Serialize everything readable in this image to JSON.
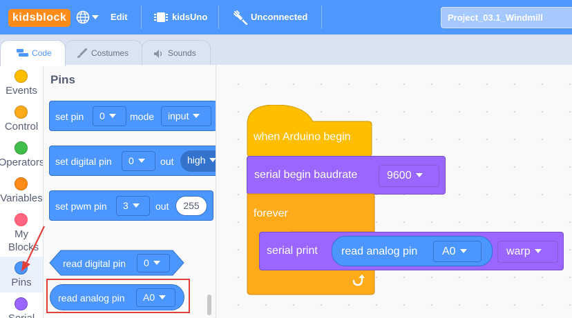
{
  "topbar": {
    "logo": "kidsblock",
    "globe_icon": "globe-icon",
    "edit_label": "Edit",
    "board_icon": "chip-icon",
    "board_label": "kidsUno",
    "connection_icon": "unplugged-icon",
    "connection_label": "Unconnected",
    "project_name": "Project_03.1_Windmill"
  },
  "tabs": [
    {
      "label": "Code",
      "icon": "code-icon",
      "active": true
    },
    {
      "label": "Costumes",
      "icon": "brush-icon",
      "active": false
    },
    {
      "label": "Sounds",
      "icon": "speaker-icon",
      "active": false
    }
  ],
  "categories": [
    {
      "label": "Events",
      "color": "#ffbf00"
    },
    {
      "label": "Control",
      "color": "#ffab19"
    },
    {
      "label": "Operators",
      "color": "#40bf4a"
    },
    {
      "label": "Variables",
      "color": "#ff8c1a"
    },
    {
      "label": "My Blocks",
      "color": "#ff6680"
    },
    {
      "label": "Pins",
      "color": "#4c97ff",
      "selected": true
    },
    {
      "label": "Serial",
      "color": "#9966ff"
    }
  ],
  "palette": {
    "title": "Pins",
    "blocks": {
      "set_pin": {
        "t1": "set pin",
        "pin": "0",
        "t2": "mode",
        "mode": "input"
      },
      "set_digital_pin": {
        "t1": "set digital pin",
        "pin": "0",
        "t2": "out",
        "level": "high"
      },
      "set_pwm_pin": {
        "t1": "set pwm pin",
        "pin": "3",
        "t2": "out",
        "value": "255"
      },
      "read_digital_pin": {
        "t1": "read digital pin",
        "pin": "0"
      },
      "read_analog_pin": {
        "t1": "read analog pin",
        "pin": "A0"
      }
    }
  },
  "script": {
    "hat": "when Arduino begin",
    "serial_begin": {
      "label": "serial begin baudrate",
      "value": "9600"
    },
    "forever": "forever",
    "serial_print": {
      "label": "serial print",
      "reporter_label": "read analog pin",
      "pin": "A0",
      "mode": "warp"
    },
    "loop_icon": "loop-arrow-icon"
  },
  "colors": {
    "menu_bar": "#4d97ff",
    "logo": "#ff8c1a",
    "pins_blocks": "#4c97ff",
    "serial_blocks": "#9966ff",
    "event_control_blocks": "#ffbf00",
    "highlight_box": "#e0403a"
  }
}
